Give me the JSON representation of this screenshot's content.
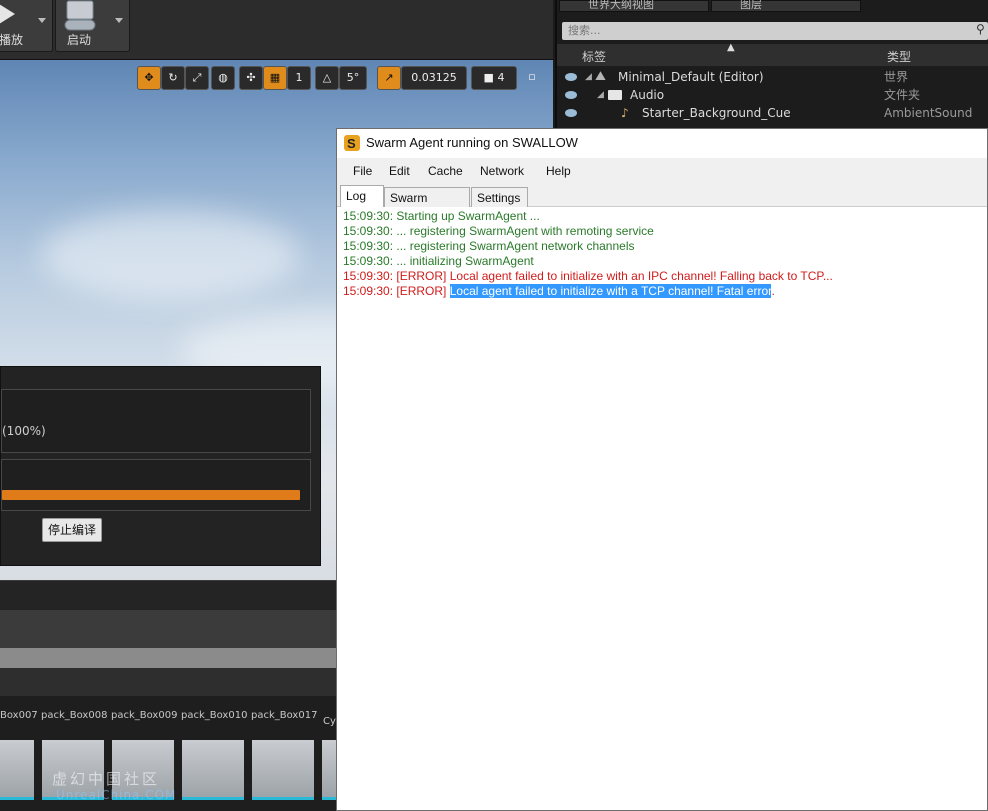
{
  "toolbar": {
    "play_label": "播放",
    "launch_label": "启动"
  },
  "viewport": {
    "tools": {
      "grid_snap": "1",
      "angle_snap": "5°",
      "scale_snap": "0.03125",
      "camera_speed": "4"
    }
  },
  "compile_dialog": {
    "progress_text": "(100%)",
    "progress_value": 1.0,
    "stop_button": "停止编译",
    "accent_color": "#e07b1a"
  },
  "content_browser": {
    "assets": [
      "Box007",
      "pack_Box008",
      "pack_Box009",
      "pack_Box010",
      "pack_Box017",
      "Cy"
    ],
    "watermark_cn": "虚幻中国社区",
    "watermark_en": "UnrealChina.COM"
  },
  "outliner": {
    "tabs": [
      "世界大纲视图",
      "图层"
    ],
    "search_placeholder": "搜索...",
    "col_label": "标签",
    "col_type": "类型",
    "rows": [
      {
        "label": "Minimal_Default (Editor)",
        "type": "世界"
      },
      {
        "label": "Audio",
        "type": "文件夹"
      },
      {
        "label": "Starter_Background_Cue",
        "type": "AmbientSound"
      }
    ]
  },
  "swarm": {
    "title": "Swarm Agent running on SWALLOW",
    "menu": [
      "File",
      "Edit",
      "Cache",
      "Network",
      "Help"
    ],
    "tabs": [
      "Log",
      "Swarm Status",
      "Settings"
    ],
    "log": [
      {
        "text": "15:09:30: Starting up SwarmAgent ...",
        "level": "ok"
      },
      {
        "text": "15:09:30:  ... registering SwarmAgent with remoting service",
        "level": "ok"
      },
      {
        "text": "15:09:30:  ... registering SwarmAgent network channels",
        "level": "ok"
      },
      {
        "text": "15:09:30:  ... initializing SwarmAgent",
        "level": "ok"
      },
      {
        "text": "15:09:30: [ERROR] Local agent failed to initialize with an IPC channel! Falling back to TCP...",
        "level": "err"
      }
    ],
    "last_log_prefix": "15:09:30: [ERROR] ",
    "last_log_selected": "Local agent failed to initialize with a TCP channel! Fatal error",
    "last_log_suffix": ".",
    "colors": {
      "ok": "#2a7a2a",
      "err": "#d11b1b",
      "selection": "#3399ff"
    }
  }
}
